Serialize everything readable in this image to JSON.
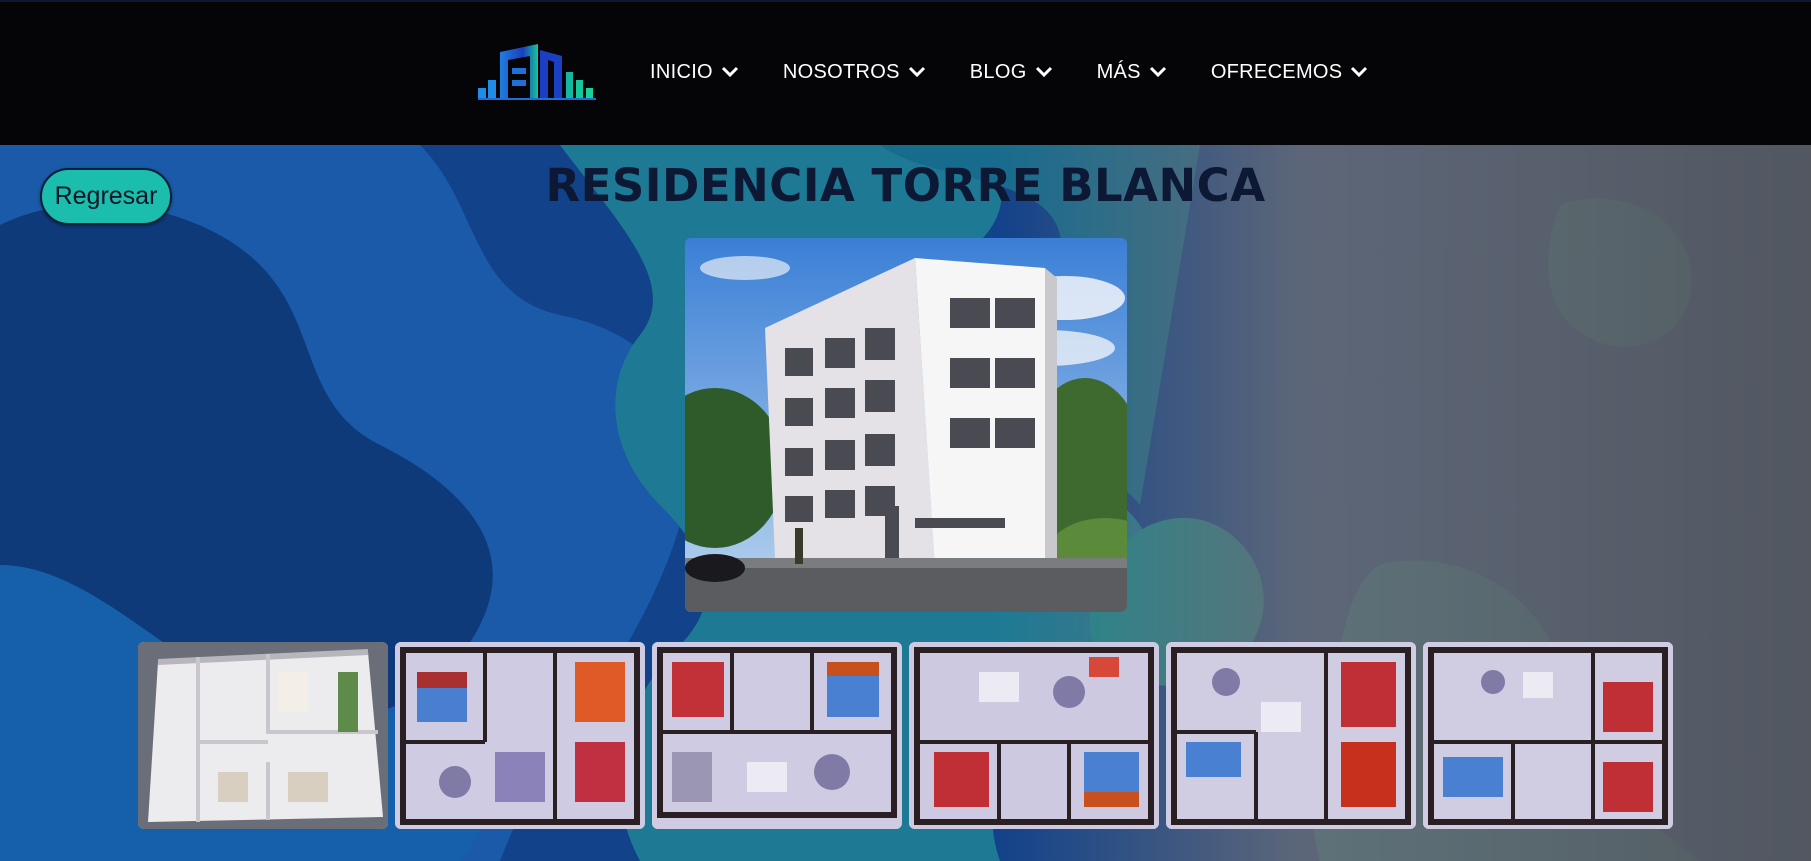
{
  "nav": {
    "logo_icon": "building-bars-logo",
    "items": [
      {
        "label": "INICIO"
      },
      {
        "label": "NOSOTROS"
      },
      {
        "label": "BLOG"
      },
      {
        "label": "MÁS"
      },
      {
        "label": "OFRECEMOS"
      }
    ]
  },
  "page": {
    "back_label": "Regresar",
    "title": "RESIDENCIA TORRE BLANCA"
  },
  "gallery": {
    "main_image": "building-exterior-render",
    "thumbnails": [
      "floor-plan-3d-render",
      "floor-plan-photo-1",
      "floor-plan-photo-2",
      "floor-plan-photo-3",
      "floor-plan-photo-4",
      "floor-plan-photo-5"
    ]
  },
  "colors": {
    "navbar": "#050507",
    "accent_button": "#1bbdad",
    "title": "#0c1834",
    "bg_blue": "#0f3d7a",
    "bg_teal": "#1a7f8f",
    "bg_gray": "#55595f"
  }
}
